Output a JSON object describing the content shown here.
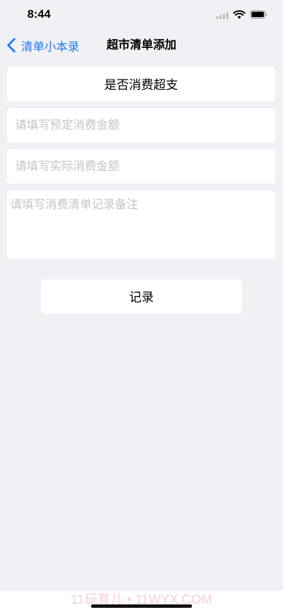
{
  "status_bar": {
    "time": "8:44"
  },
  "nav": {
    "back_label": "清单小本录",
    "title": "超市清单添加"
  },
  "form": {
    "overspend_label": "是否消费超支",
    "planned_amount_placeholder": "请填写预定消费金额",
    "actual_amount_placeholder": "请填写实际消费金额",
    "note_placeholder": "请填写消费清单记录备注",
    "record_button": "记录"
  },
  "watermark": "11玩育儿 • 11WYX.COM",
  "colors": {
    "accent": "#1f7bf4",
    "background": "#f1f0f5",
    "card": "#ffffff",
    "placeholder": "#c4c4c6"
  }
}
